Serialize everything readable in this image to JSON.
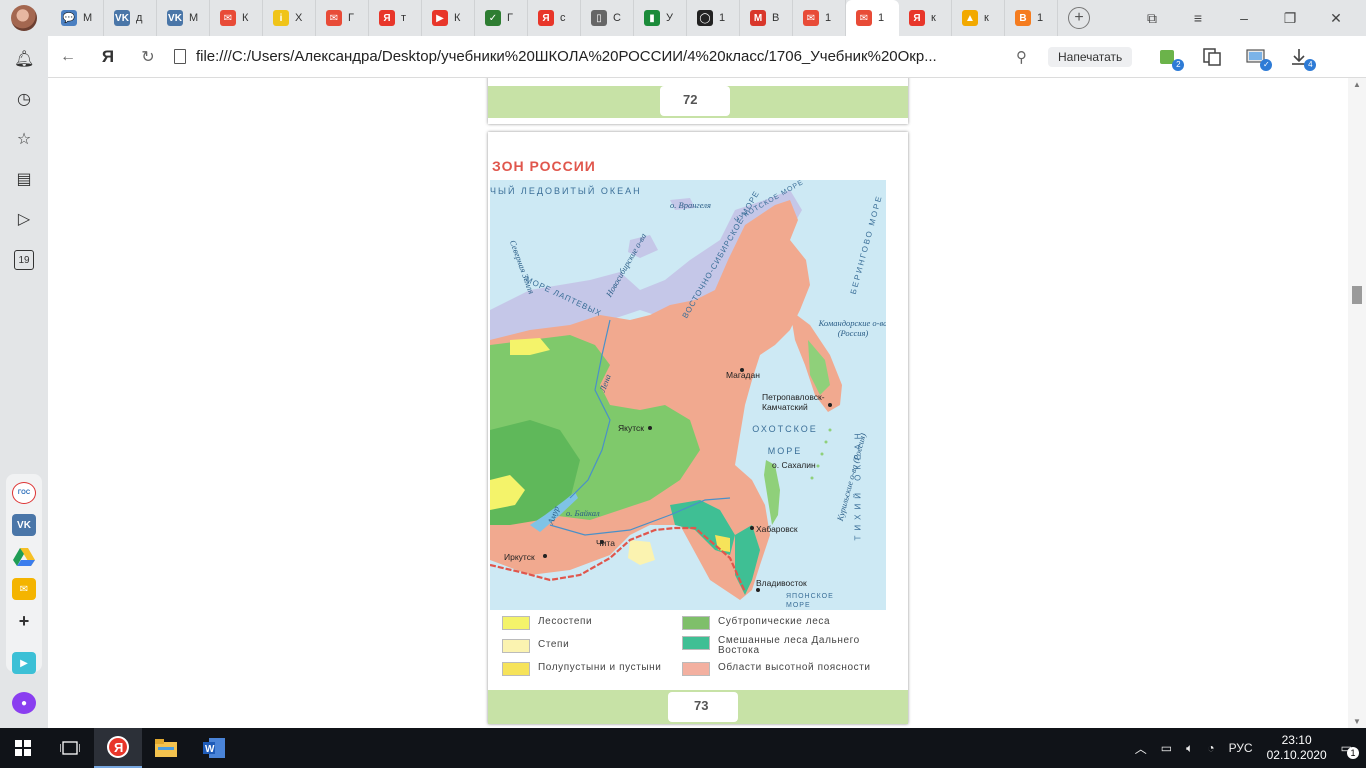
{
  "tabs": [
    {
      "letter": "М",
      "color": "#4a7fc1",
      "glyph": "💬"
    },
    {
      "letter": "д",
      "color": "#4a76a8",
      "glyph": "VK"
    },
    {
      "letter": "М",
      "color": "#4a76a8",
      "glyph": "VK"
    },
    {
      "letter": "К",
      "color": "#e84b37",
      "glyph": "✉"
    },
    {
      "letter": "Х",
      "color": "#f0c419",
      "glyph": "i"
    },
    {
      "letter": "Г",
      "color": "#e84b37",
      "glyph": "✉"
    },
    {
      "letter": "т",
      "color": "#e8362a",
      "glyph": "Я"
    },
    {
      "letter": "К",
      "color": "#e8362a",
      "glyph": "▶"
    },
    {
      "letter": "Г",
      "color": "#2e7d32",
      "glyph": "✓"
    },
    {
      "letter": "с",
      "color": "#e8362a",
      "glyph": "Я"
    },
    {
      "letter": "С",
      "color": "#666666",
      "glyph": "▯"
    },
    {
      "letter": "У",
      "color": "#1b8b3a",
      "glyph": "▮"
    },
    {
      "letter": "1",
      "color": "#222222",
      "glyph": "◯"
    },
    {
      "letter": "В",
      "color": "#d9372b",
      "glyph": "M"
    },
    {
      "letter": "1",
      "color": "#e84b37",
      "glyph": "✉"
    },
    {
      "letter": "1",
      "color": "#e84b37",
      "glyph": "✉",
      "active": true
    },
    {
      "letter": "к",
      "color": "#e8362a",
      "glyph": "Я"
    },
    {
      "letter": "к",
      "color": "#f2a900",
      "glyph": "▲"
    },
    {
      "letter": "1",
      "color": "#f57c1f",
      "glyph": "B"
    }
  ],
  "address": {
    "url": "file:///C:/Users/Александра/Desktop/учебники%20ШКОЛА%20РОССИИ/4%20класс/1706_Учебник%20Окр...",
    "print_label": "Напечатать",
    "badge_ext1": "2",
    "badge_downloads": "4"
  },
  "document": {
    "page_prev_number": "72",
    "page_number": "73",
    "title": "ЗОН РОССИИ",
    "map_labels": {
      "arctic_ocean": "ЧЫЙ ЛЕДОВИТЫЙ ОКЕАН",
      "wrangel": "о. Врангеля",
      "chukchi": "ЧУКОТСКОЕ МОРЕ",
      "east_siberian": "ВОСТОЧНО-СИБИРСКОЕ МОРЕ",
      "novosibirsk": "Новосибирские о-ва",
      "severnaya": "Северная Земля",
      "laptev": "МОРЕ ЛАПТЕВЫХ",
      "bering": "БЕРИНГОВО МОРЕ",
      "komandor": "Командорские о-ва (Россия)",
      "magadan": "Магадан",
      "petropavlovsk": "Петропавловск-Камчатский",
      "okhotsk": "ОХОТСКОЕ МОРЕ",
      "sakhalin": "о. Сахалин",
      "kuril": "Курильские о-ва (Россия)",
      "yakutsk": "Якутск",
      "baikal": "о. Байкал",
      "irkutsk": "Иркутск",
      "chita": "Чита",
      "khabarovsk": "Хабаровск",
      "vladivostok": "Владивосток",
      "japanese": "ЯПОНСКОЕ МОРЕ",
      "pacific": "ТИХИЙ ОКЕАН",
      "lena": "Лена",
      "amur": "Амур"
    },
    "legend": [
      {
        "label": "Лесостепи",
        "color": "#f4f36a"
      },
      {
        "label": "Степи",
        "color": "#fbf3b0"
      },
      {
        "label": "Полупустыни и пустыни",
        "color": "#f6e35a"
      },
      {
        "label": "Субтропические леса",
        "color": "#7fbf6a"
      },
      {
        "label": "Смешанные леса Дальнего Востока",
        "color": "#3fbf94"
      },
      {
        "label": "Области высотной поясности",
        "color": "#f3b0a0"
      }
    ]
  },
  "taskbar": {
    "lang": "РУС",
    "time": "23:10",
    "date": "02.10.2020",
    "notifications": "1"
  }
}
